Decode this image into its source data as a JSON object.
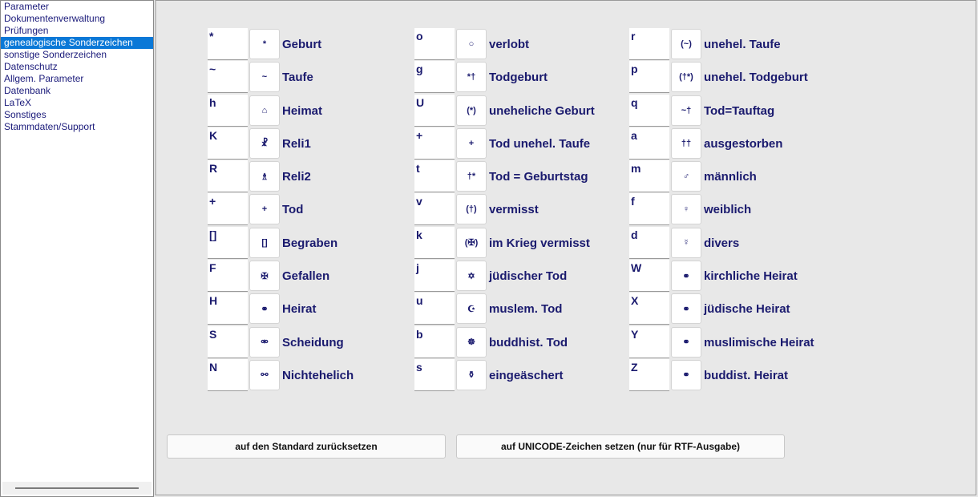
{
  "sidebar": {
    "items": [
      {
        "label": "Parameter",
        "selected": false
      },
      {
        "label": "Dokumentenverwaltung",
        "selected": false
      },
      {
        "label": "Prüfungen",
        "selected": false
      },
      {
        "label": "genealogische Sonderzeichen",
        "selected": true
      },
      {
        "label": "sonstige Sonderzeichen",
        "selected": false
      },
      {
        "label": "Datenschutz",
        "selected": false
      },
      {
        "label": "Allgem. Parameter",
        "selected": false
      },
      {
        "label": "Datenbank",
        "selected": false
      },
      {
        "label": "LaTeX",
        "selected": false
      },
      {
        "label": "Sonstiges",
        "selected": false
      },
      {
        "label": "Stammdaten/Support",
        "selected": false
      }
    ]
  },
  "columns": [
    [
      {
        "code": "*",
        "glyph": "*",
        "label": "Geburt"
      },
      {
        "code": "~",
        "glyph": "~",
        "label": "Taufe"
      },
      {
        "code": "h",
        "glyph": "⌂",
        "label": "Heimat"
      },
      {
        "code": "K",
        "glyph": "☧",
        "label": "Reli1"
      },
      {
        "code": "R",
        "glyph": "♗",
        "label": "Reli2"
      },
      {
        "code": "+",
        "glyph": "+",
        "label": "Tod"
      },
      {
        "code": "[]",
        "glyph": "[]",
        "label": "Begraben"
      },
      {
        "code": "F",
        "glyph": "✠",
        "label": "Gefallen"
      },
      {
        "code": "H",
        "glyph": "⚭",
        "label": "Heirat"
      },
      {
        "code": "S",
        "glyph": "⚮",
        "label": "Scheidung"
      },
      {
        "code": "N",
        "glyph": "⚯",
        "label": "Nichtehelich"
      }
    ],
    [
      {
        "code": "o",
        "glyph": "○",
        "label": "verlobt"
      },
      {
        "code": "g",
        "glyph": "*†",
        "label": "Todgeburt"
      },
      {
        "code": "U",
        "glyph": "(*)",
        "label": "uneheliche Geburt"
      },
      {
        "code": "+",
        "glyph": "+",
        "label": "Tod unehel. Taufe"
      },
      {
        "code": "t",
        "glyph": "†*",
        "label": "Tod = Geburtstag"
      },
      {
        "code": "v",
        "glyph": "(†)",
        "label": "vermisst"
      },
      {
        "code": "k",
        "glyph": "(✠)",
        "label": "im Krieg vermisst"
      },
      {
        "code": "j",
        "glyph": "✡",
        "label": "jüdischer Tod"
      },
      {
        "code": "u",
        "glyph": "☪",
        "label": "muslem. Tod"
      },
      {
        "code": "b",
        "glyph": "☸",
        "label": "buddhist. Tod"
      },
      {
        "code": "s",
        "glyph": "⚱",
        "label": "eingeäschert"
      }
    ],
    [
      {
        "code": "r",
        "glyph": "(~)",
        "label": "unehel. Taufe"
      },
      {
        "code": "p",
        "glyph": "(†*)",
        "label": "unehel. Todgeburt"
      },
      {
        "code": "q",
        "glyph": "~†",
        "label": "Tod=Tauftag"
      },
      {
        "code": "a",
        "glyph": "††",
        "label": "ausgestorben"
      },
      {
        "code": "m",
        "glyph": "♂",
        "label": "männlich"
      },
      {
        "code": "f",
        "glyph": "♀",
        "label": "weiblich"
      },
      {
        "code": "d",
        "glyph": "☿",
        "label": "divers"
      },
      {
        "code": "W",
        "glyph": "⚭",
        "label": "kirchliche Heirat"
      },
      {
        "code": "X",
        "glyph": "⚭",
        "label": "jüdische Heirat"
      },
      {
        "code": "Y",
        "glyph": "⚭",
        "label": "muslimische Heirat"
      },
      {
        "code": "Z",
        "glyph": "⚭",
        "label": "buddist. Heirat"
      }
    ]
  ],
  "buttons": {
    "reset_label": "auf den Standard zurücksetzen",
    "unicode_label": "auf UNICODE-Zeichen setzen (nur für RTF-Ausgabe)"
  }
}
